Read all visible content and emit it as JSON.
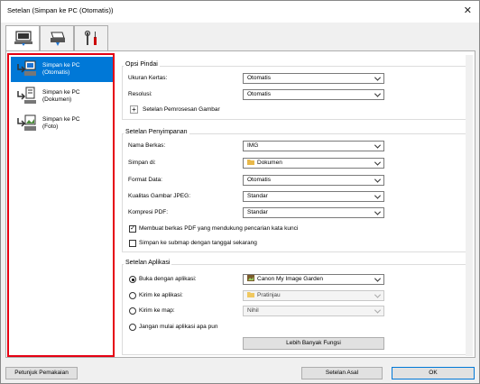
{
  "window": {
    "title": "Setelan (Simpan ke PC (Otomatis))",
    "close_glyph": "✕"
  },
  "tabs": [
    {
      "icon": "computer-scan-icon"
    },
    {
      "icon": "scanner-icon"
    },
    {
      "icon": "tools-icon"
    }
  ],
  "sidebar": {
    "items": [
      {
        "label": "Simpan ke PC\n(Otomatis)",
        "selected": true
      },
      {
        "label": "Simpan ke PC\n(Dokumen)",
        "selected": false
      },
      {
        "label": "Simpan ke PC\n(Foto)",
        "selected": false
      }
    ]
  },
  "scan_options": {
    "title": "Opsi Pindai",
    "paper_size_label": "Ukuran Kertas:",
    "paper_size_value": "Otomatis",
    "resolution_label": "Resolusi:",
    "resolution_value": "Otomatis",
    "image_processing_label": "Setelan Pemrosesan Gambar",
    "expand_glyph": "+"
  },
  "save_settings": {
    "title": "Setelan Penyimpanan",
    "file_name_label": "Nama Berkas:",
    "file_name_value": "IMG",
    "save_in_label": "Simpan di:",
    "save_in_value": "Dokumen",
    "data_format_label": "Format Data:",
    "data_format_value": "Otomatis",
    "jpeg_quality_label": "Kualitas Gambar JPEG:",
    "jpeg_quality_value": "Standar",
    "pdf_compression_label": "Kompresi PDF:",
    "pdf_compression_value": "Standar",
    "searchable_pdf_label": "Membuat berkas PDF yang mendukung pencarian kata kunci",
    "searchable_pdf_checked": true,
    "subfolder_label": "Simpan ke submap dengan tanggal sekarang",
    "subfolder_checked": false,
    "check_glyph": "✓"
  },
  "app_settings": {
    "title": "Setelan Aplikasi",
    "open_with_label": "Buka dengan aplikasi:",
    "open_with_value": "Canon My Image Garden",
    "send_to_app_label": "Kirim ke aplikasi:",
    "send_to_app_value": "Pratinjau",
    "send_to_folder_label": "Kirim ke map:",
    "send_to_folder_value": "Nihil",
    "do_not_start_label": "Jangan mulai aplikasi apa pun",
    "selected_option": "open_with",
    "more_functions_label": "Lebih Banyak Fungsi"
  },
  "footer": {
    "instructions_label": "Petunjuk Pemakaian",
    "defaults_label": "Setelan Asal",
    "ok_label": "OK"
  },
  "colors": {
    "selection": "#0078d7",
    "highlight_border": "#e60012"
  }
}
